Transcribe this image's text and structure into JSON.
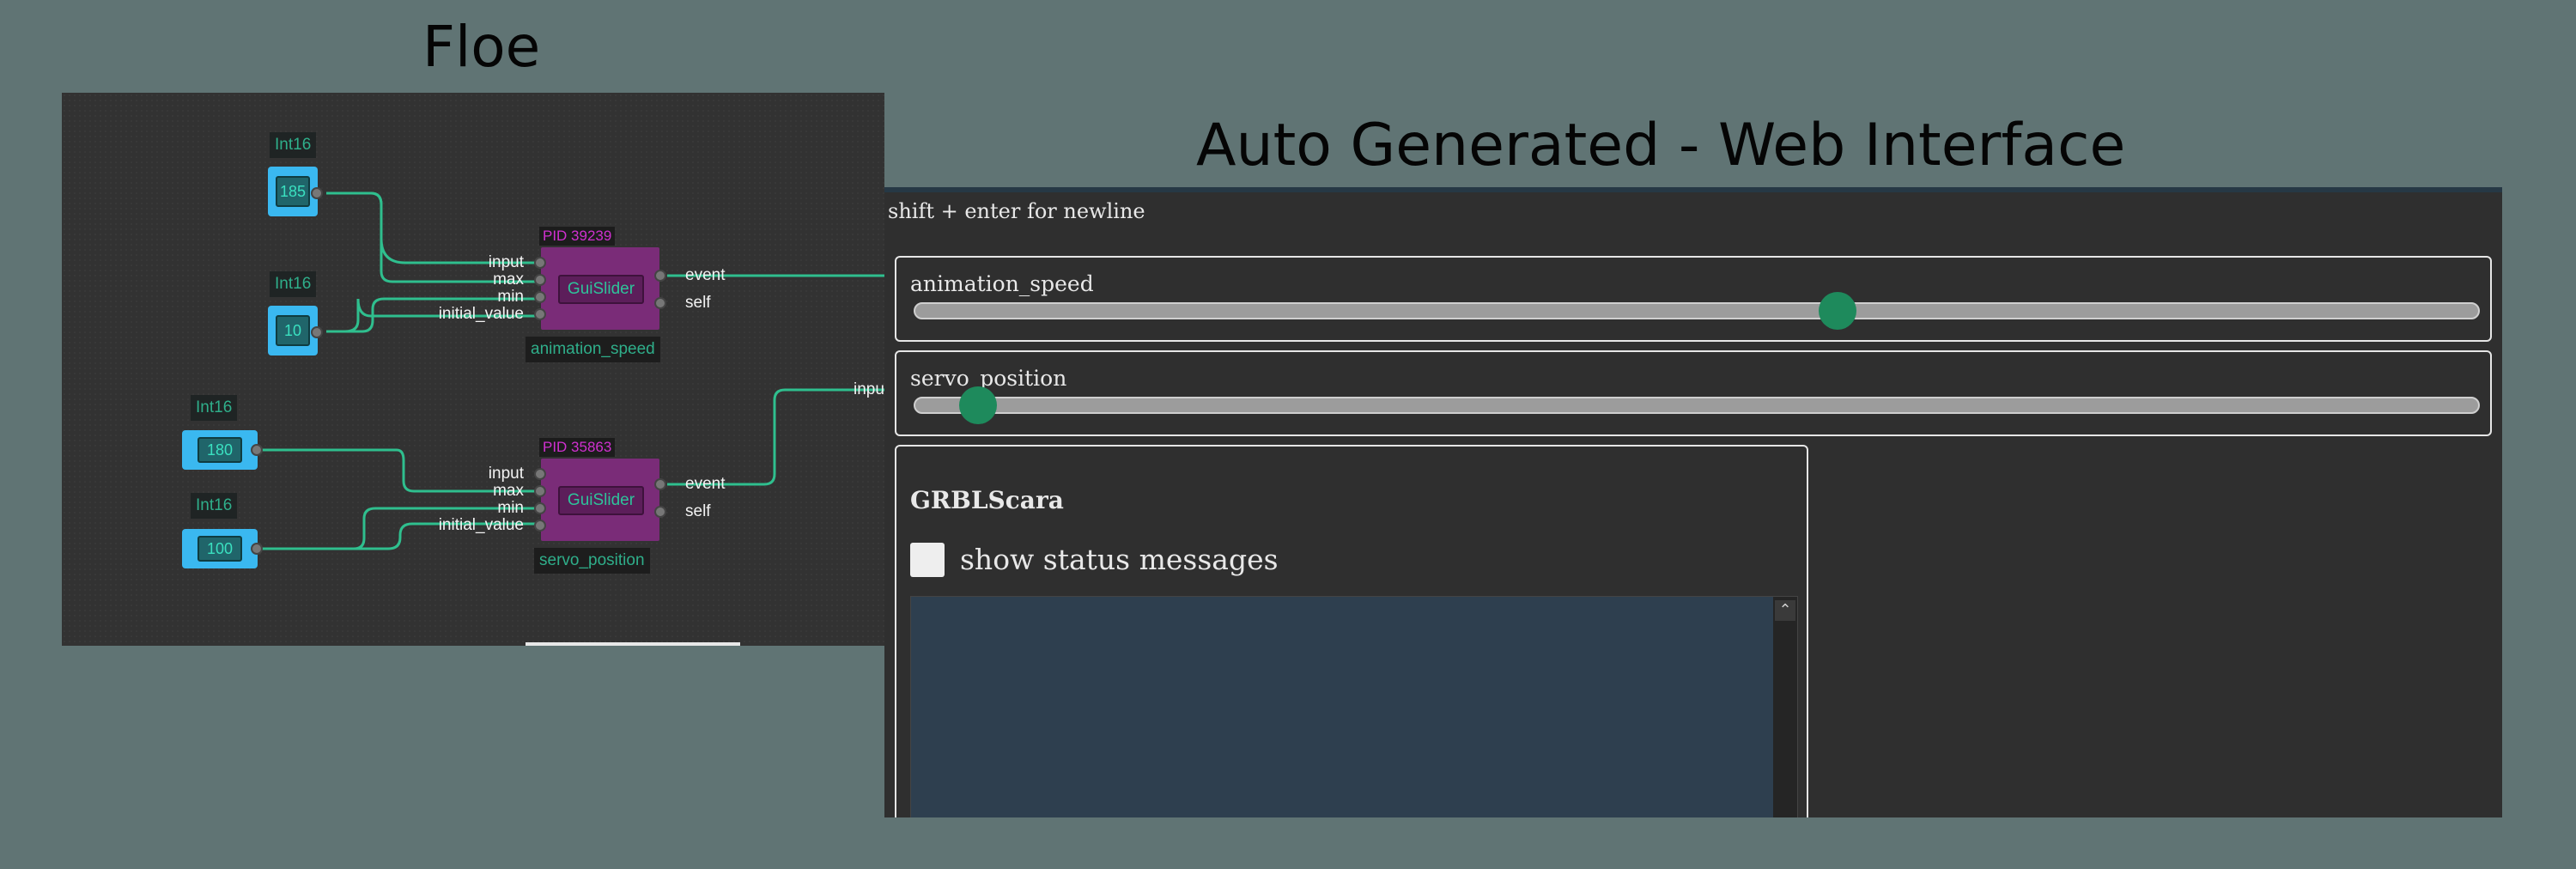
{
  "titles": {
    "floe": "Floe",
    "web": "Auto Generated - Web Interface"
  },
  "floe": {
    "value_nodes": [
      {
        "type": "Int16",
        "value": "185"
      },
      {
        "type": "Int16",
        "value": "10"
      },
      {
        "type": "Int16",
        "value": "180"
      },
      {
        "type": "Int16",
        "value": "100"
      }
    ],
    "slider_nodes": [
      {
        "pid": "PID 39239",
        "label": "GuiSlider",
        "name": "animation_speed",
        "inputs": [
          "input",
          "max",
          "min",
          "initial_value"
        ],
        "outputs": [
          "event",
          "self"
        ]
      },
      {
        "pid": "PID 35863",
        "label": "GuiSlider",
        "name": "servo_position",
        "inputs": [
          "input",
          "max",
          "min",
          "initial_value"
        ],
        "outputs": [
          "event",
          "self"
        ]
      }
    ],
    "offscreen_input_label": "inpu"
  },
  "web": {
    "hint": "shift + enter for newline",
    "sliders": [
      {
        "label": "animation_speed",
        "value_fraction": 0.59
      },
      {
        "label": "servo_position",
        "value_fraction": 0.04
      }
    ],
    "grbl": {
      "title": "GRBLScara",
      "checkbox_label": "show status messages",
      "checkbox_checked": false
    }
  },
  "colors": {
    "background": "#607474",
    "wire": "#2fbf8e",
    "value_node": "#3ab8f0",
    "slider_node": "#7a2c78",
    "thumb": "#1e8a5c"
  }
}
